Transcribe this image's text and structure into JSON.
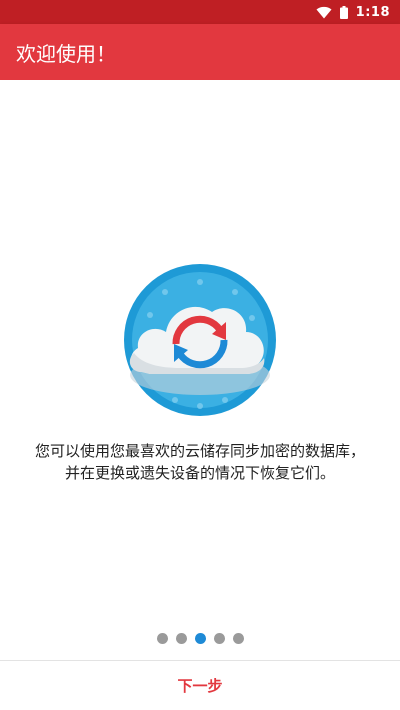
{
  "status_bar": {
    "time": "1:18",
    "icons": [
      "wifi-icon",
      "battery-icon"
    ]
  },
  "app_bar": {
    "title": "欢迎使用！"
  },
  "onboarding": {
    "illustration_icon": "cloud-sync-icon",
    "description_line1": "您可以使用您最喜欢的云储存同步加密的数据库，",
    "description_line2": "并在更换或遗失设备的情况下恢复它们。",
    "page_count": 5,
    "current_page": 3
  },
  "footer": {
    "next_label": "下一步"
  },
  "colors": {
    "status_bar": "#bf1f24",
    "app_bar": "#e2383f",
    "accent_blue": "#1e8ad6",
    "dot_inactive": "#9a9a9a"
  }
}
